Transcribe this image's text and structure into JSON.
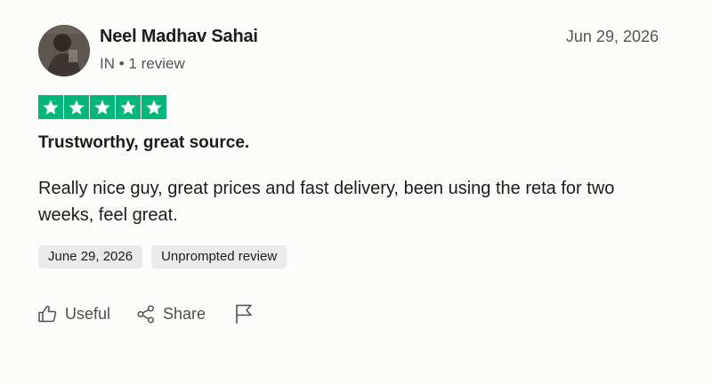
{
  "review": {
    "reviewer": {
      "name": "Neel Madhav Sahai",
      "country": "IN",
      "separator": "•",
      "review_count": "1 review",
      "avatar_icon": "user-photo"
    },
    "date": "Jun 29, 2026",
    "rating": 5,
    "rating_max": 5,
    "star_color": "#00b67a",
    "title": "Trustworthy, great source.",
    "body": "Really nice guy, great prices and fast delivery, been using the reta for two weeks, feel great.",
    "tags": {
      "experience_date": "June 29, 2026",
      "review_type": "Unprompted review"
    },
    "actions": {
      "useful_label": "Useful",
      "useful_icon": "thumbs-up-icon",
      "share_label": "Share",
      "share_icon": "share-icon",
      "report_icon": "flag-icon"
    }
  }
}
